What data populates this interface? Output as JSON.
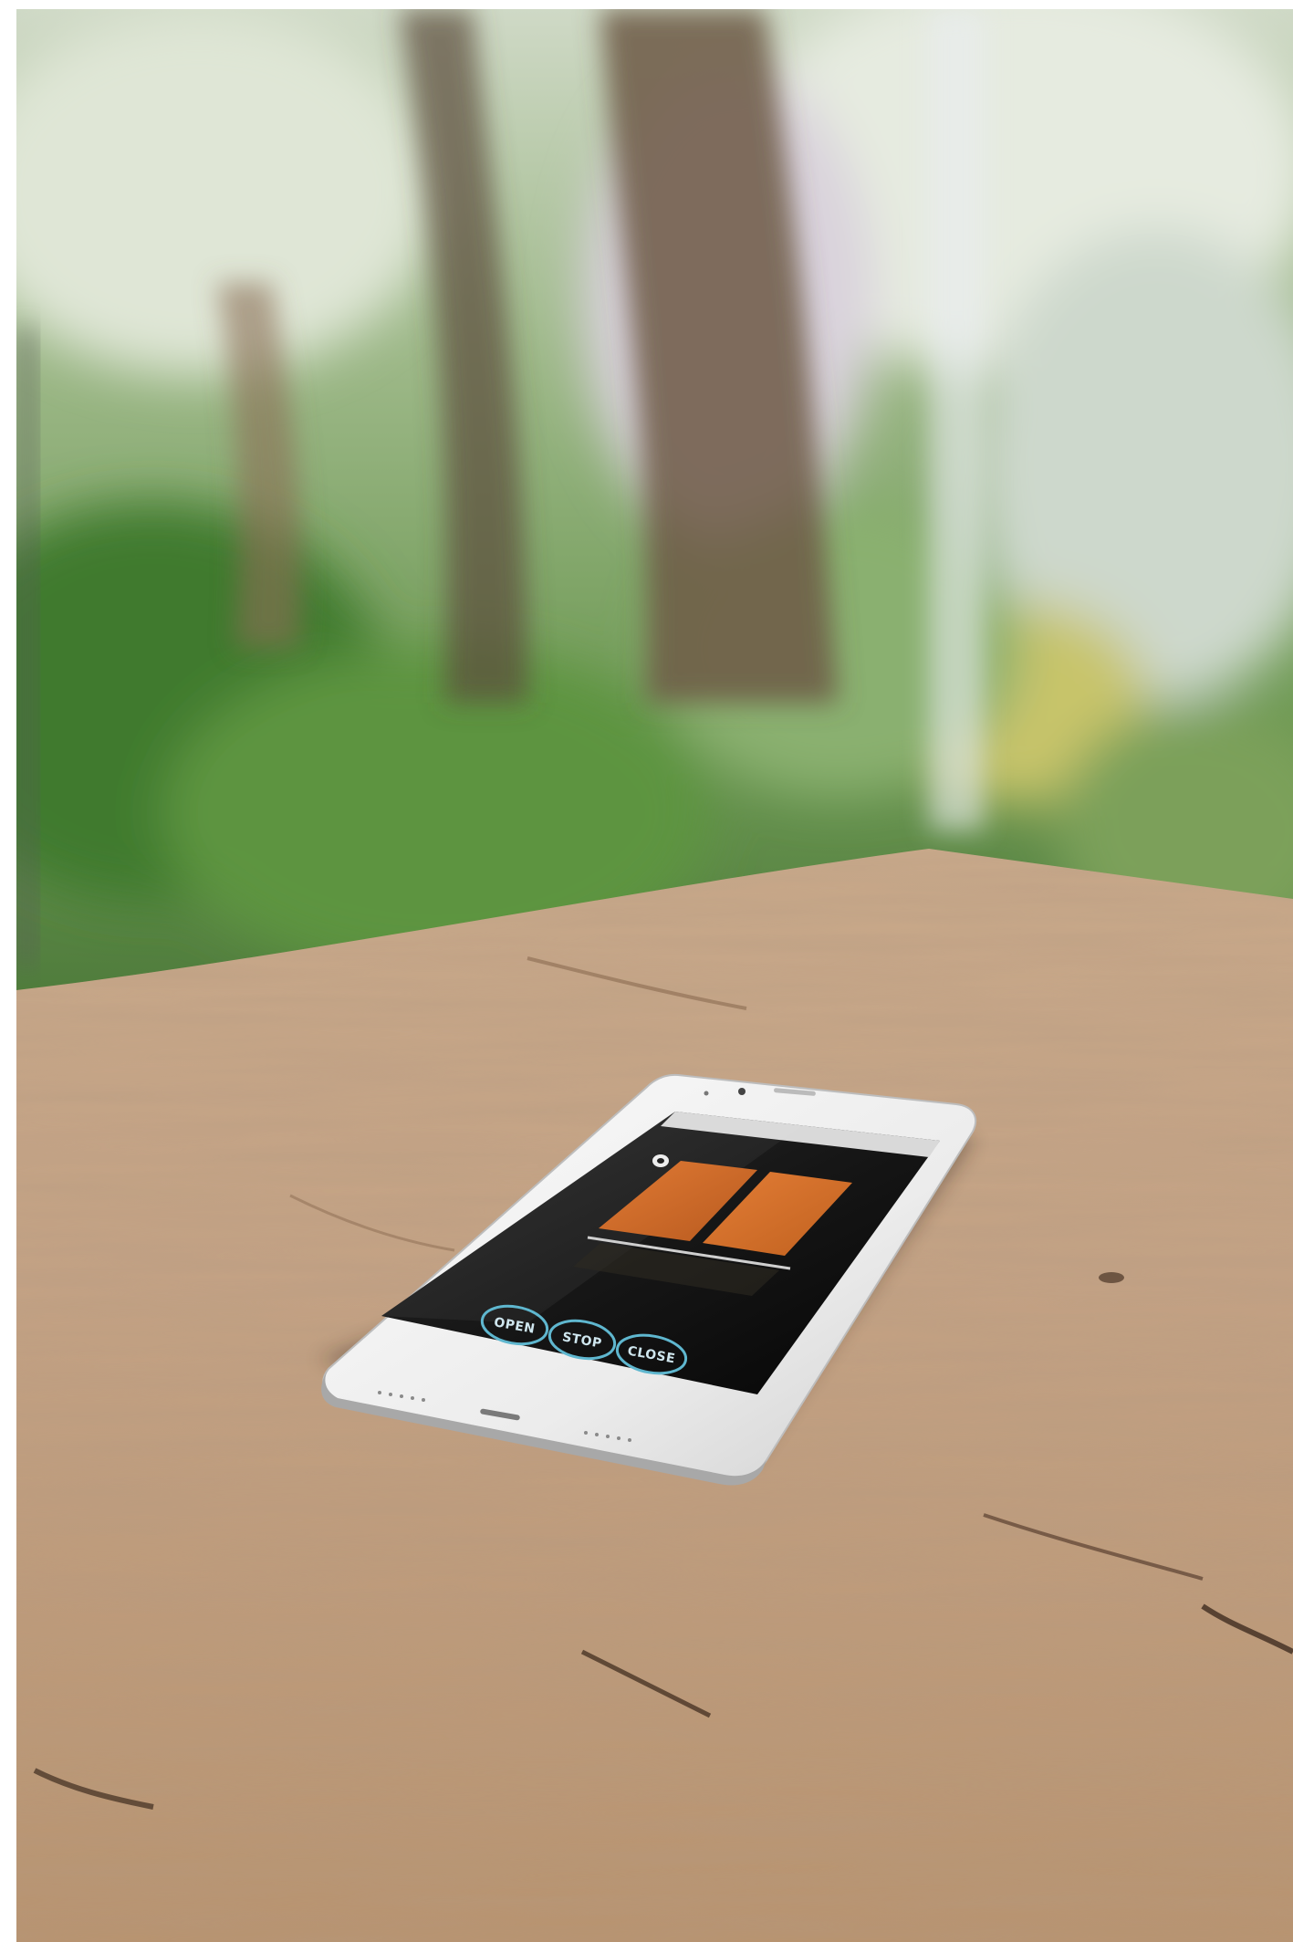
{
  "scene": {
    "description_free": true
  },
  "phone_app": {
    "buttons": [
      {
        "label": "OPEN"
      },
      {
        "label": "STOP"
      },
      {
        "label": "CLOSE"
      }
    ],
    "accent_color": "#d9702c",
    "button_ring_color": "#5fb7cf",
    "screen_background": "#111111"
  }
}
